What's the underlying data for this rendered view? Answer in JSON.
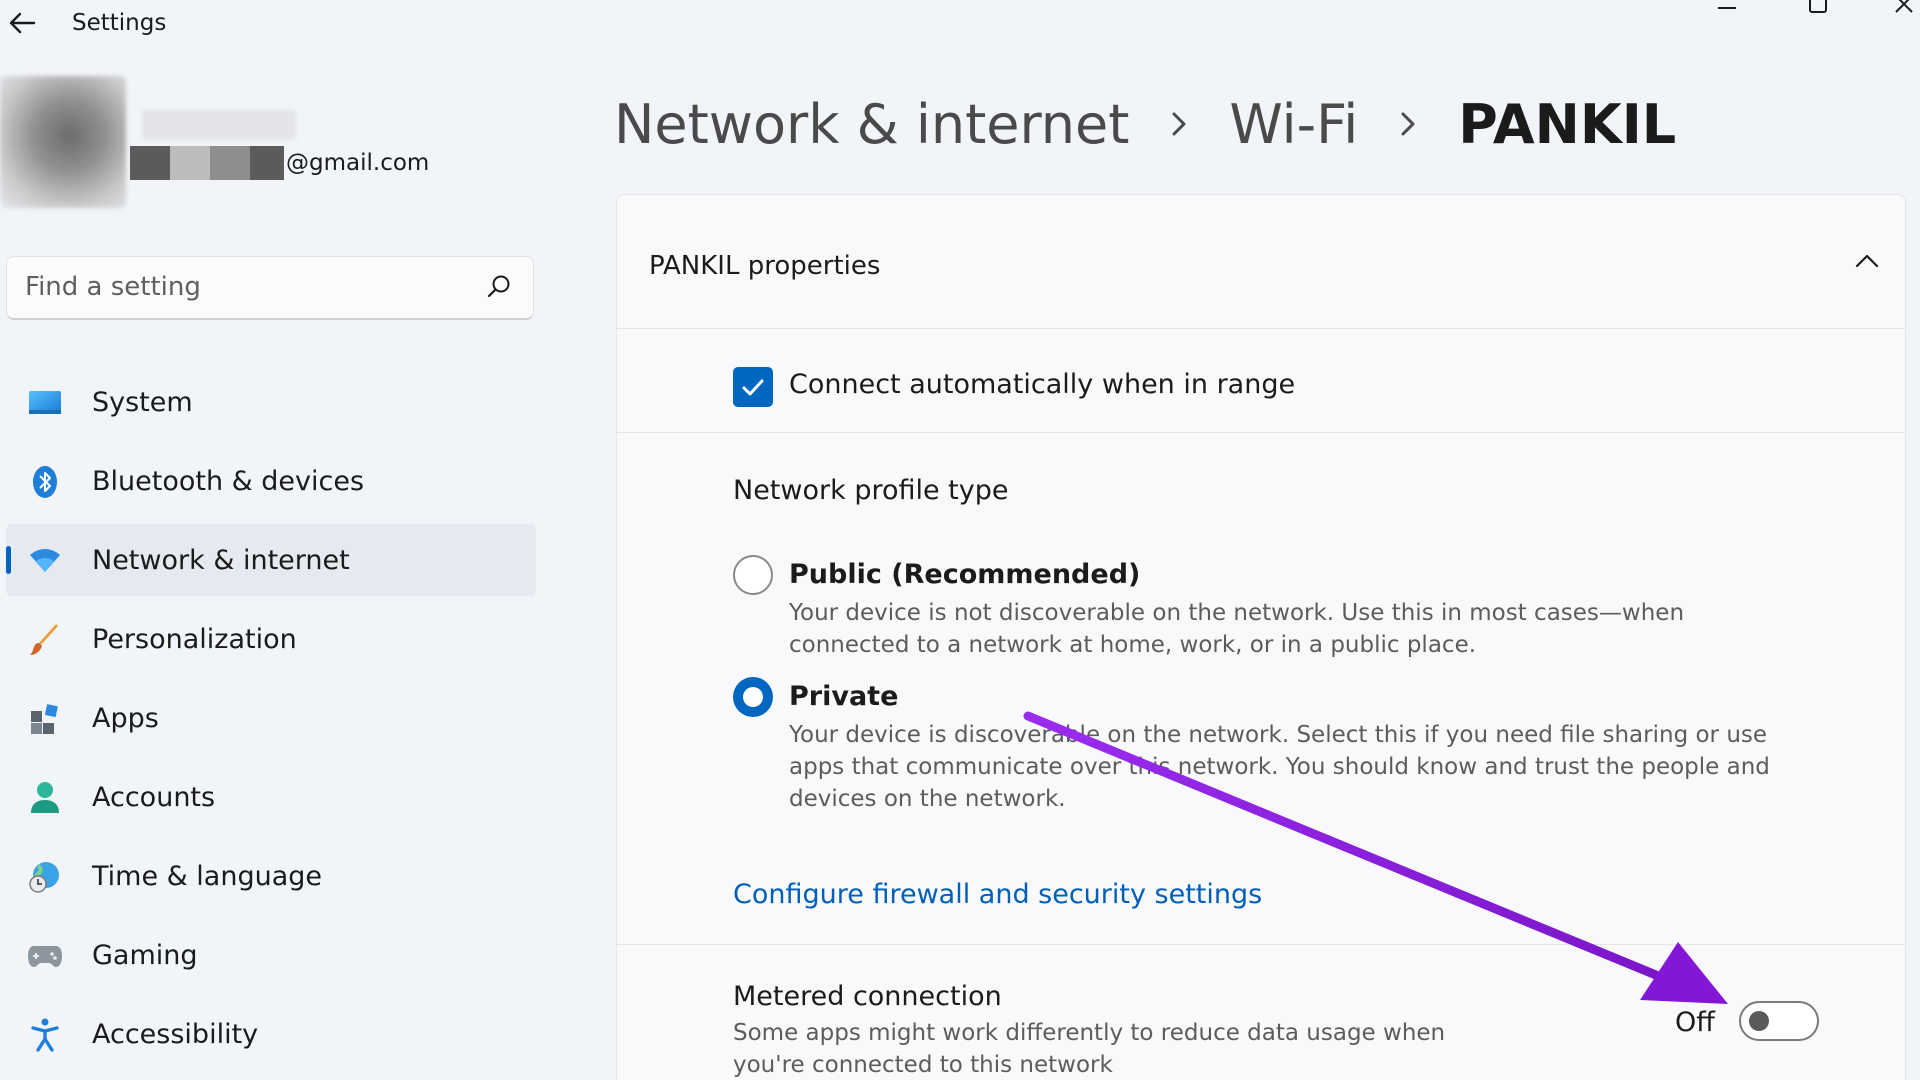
{
  "window": {
    "title": "Settings"
  },
  "account": {
    "email_suffix": "@gmail.com"
  },
  "search": {
    "placeholder": "Find a setting"
  },
  "sidebar": {
    "items": [
      {
        "label": "System",
        "icon": "system-icon",
        "active": false
      },
      {
        "label": "Bluetooth & devices",
        "icon": "bluetooth-icon",
        "active": false
      },
      {
        "label": "Network & internet",
        "icon": "wifi-icon",
        "active": true
      },
      {
        "label": "Personalization",
        "icon": "brush-icon",
        "active": false
      },
      {
        "label": "Apps",
        "icon": "apps-icon",
        "active": false
      },
      {
        "label": "Accounts",
        "icon": "person-icon",
        "active": false
      },
      {
        "label": "Time & language",
        "icon": "globe-clock-icon",
        "active": false
      },
      {
        "label": "Gaming",
        "icon": "gamepad-icon",
        "active": false
      },
      {
        "label": "Accessibility",
        "icon": "accessibility-icon",
        "active": false
      }
    ]
  },
  "breadcrumb": {
    "items": [
      "Network & internet",
      "Wi-Fi",
      "PANKIL"
    ]
  },
  "properties": {
    "title": "PANKIL properties",
    "connect_auto_label": "Connect automatically when in range",
    "connect_auto_checked": true,
    "profile_type_title": "Network profile type",
    "public": {
      "label": "Public (Recommended)",
      "description": "Your device is not discoverable on the network. Use this in most cases—when connected to a network at home, work, or in a public place.",
      "selected": false
    },
    "private": {
      "label": "Private",
      "description": "Your device is discoverable on the network. Select this if you need file sharing or use apps that communicate over this network. You should know and trust the people and devices on the network.",
      "selected": true
    },
    "firewall_link": "Configure firewall and security settings",
    "metered": {
      "title": "Metered connection",
      "description": "Some apps might work differently to reduce data usage when you're connected to this network",
      "toggle_state_label": "Off",
      "on": false
    }
  },
  "colors": {
    "accent": "#0067c0",
    "annotation_arrow": "#8a1fd6"
  }
}
